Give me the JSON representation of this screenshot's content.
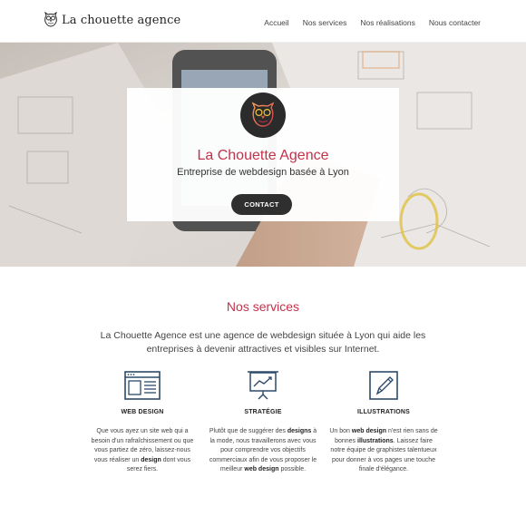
{
  "header": {
    "logo_text": "La chouette agence",
    "nav": [
      "Accueil",
      "Nos services",
      "Nos réalisations",
      "Nous contacter"
    ]
  },
  "hero": {
    "title": "La Chouette Agence",
    "subtitle": "Entreprise de webdesign basée à Lyon",
    "button_label": "CONTACT"
  },
  "services": {
    "title": "Nos services",
    "intro": "La Chouette Agence est une agence de webdesign située à Lyon qui aide les entreprises à devenir attractives et visibles sur Internet.",
    "items": [
      {
        "icon": "web-design-icon",
        "title": "WEB DESIGN",
        "text_parts": [
          "Que vous ayez un site web qui a besoin d'un rafraîchissement ou que vous partiez de zéro, laissez-nous vous réaliser un ",
          "design",
          " dont vous serez fiers."
        ]
      },
      {
        "icon": "strategy-chart-icon",
        "title": "STRATÉGIE",
        "text_parts": [
          "Plutôt que de suggérer des ",
          "designs",
          " à la mode, nous travaillerons avec vous pour comprendre vos objectifs commerciaux afin de vous proposer le meilleur ",
          "web design",
          " possible."
        ]
      },
      {
        "icon": "pencil-illustration-icon",
        "title": "ILLUSTRATIONS",
        "text_parts": [
          "Un bon ",
          "web design",
          " n'est rien sans de bonnes ",
          "illustrations",
          ". Laissez faire notre équipe de graphistes talentueux pour donner à vos pages une touche finale d'élégance."
        ]
      }
    ]
  },
  "colors": {
    "accent": "#c4314b",
    "dark_button": "#2f2f2f",
    "icon_blue": "#2d4a6b"
  }
}
